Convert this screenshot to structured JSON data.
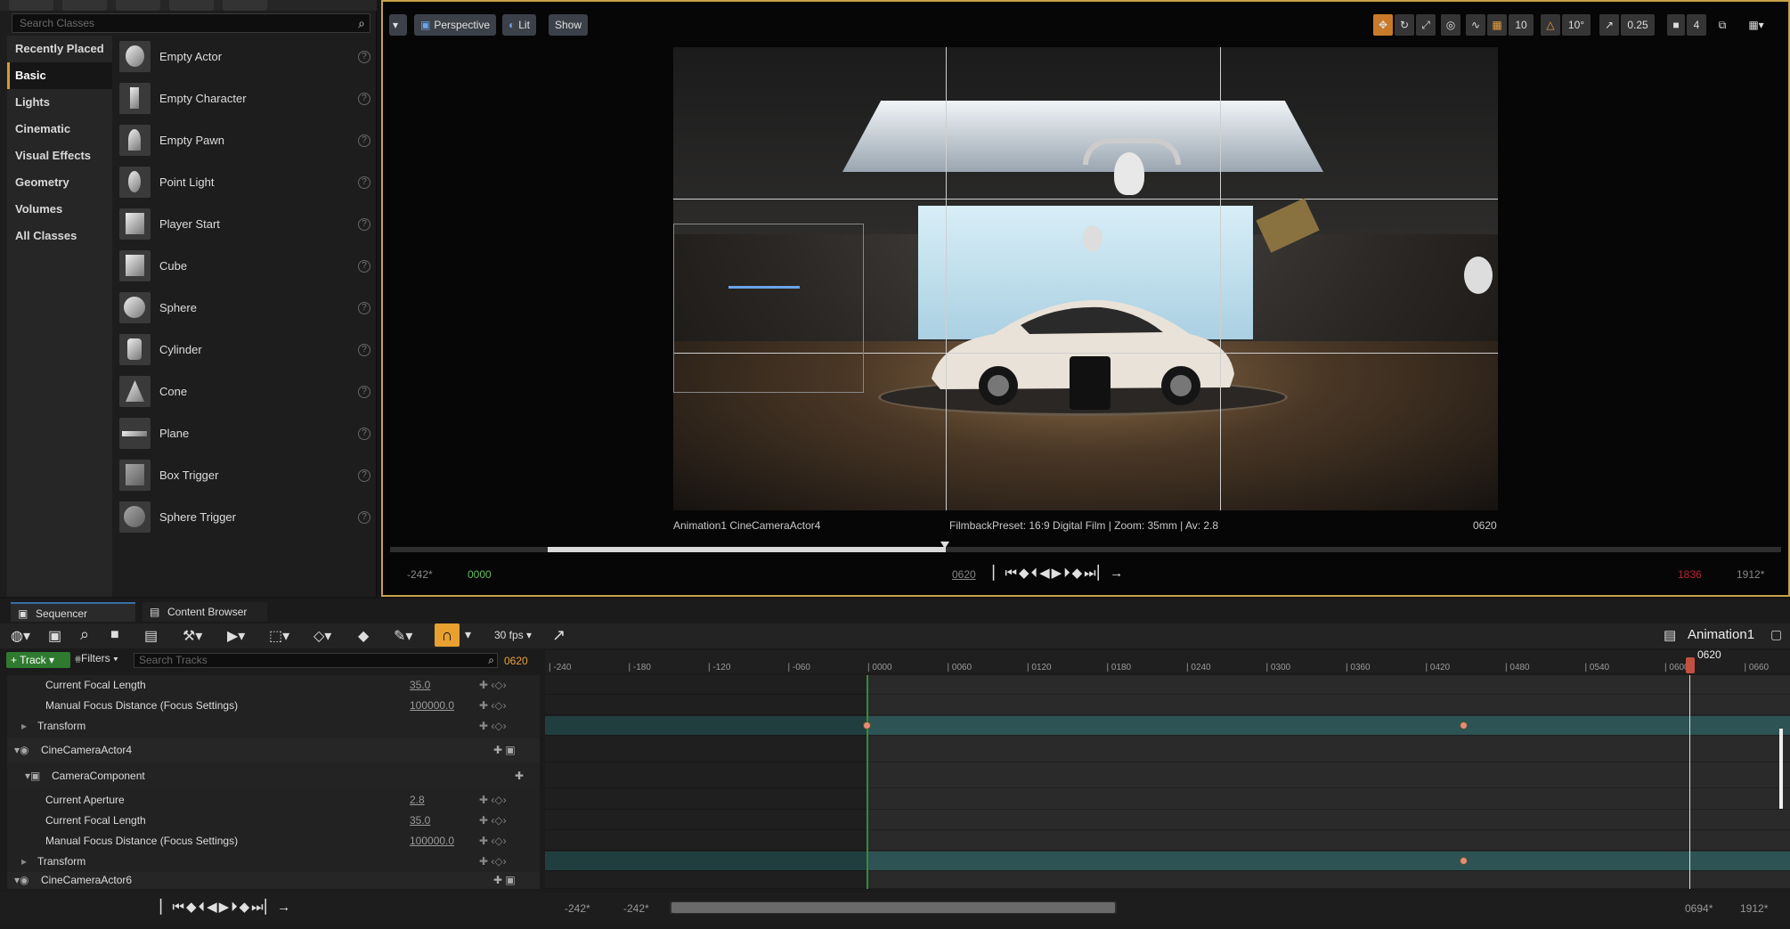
{
  "place_panel": {
    "search_placeholder": "Search Classes",
    "categories": [
      "Recently Placed",
      "Basic",
      "Lights",
      "Cinematic",
      "Visual Effects",
      "Geometry",
      "Volumes",
      "All Classes"
    ],
    "selected_category": "Basic",
    "items": [
      "Empty Actor",
      "Empty Character",
      "Empty Pawn",
      "Point Light",
      "Player Start",
      "Cube",
      "Sphere",
      "Cylinder",
      "Cone",
      "Plane",
      "Box Trigger",
      "Sphere Trigger"
    ]
  },
  "viewport": {
    "perspective_label": "Perspective",
    "lit_label": "Lit",
    "show_label": "Show",
    "grid_value": "10",
    "rotation_value": "10°",
    "scale_value": "0.25",
    "camera_speed": "4",
    "info_left": "Animation1  CineCameraActor4",
    "info_center": "FilmbackPreset: 16:9 Digital Film | Zoom: 35mm | Av: 2.8",
    "info_right": "0620",
    "start_time": "-242*",
    "in_time": "0000",
    "current_time": "0620",
    "out_time": "1836",
    "end_time": "1912*"
  },
  "sequencer": {
    "tab_sequencer": "Sequencer",
    "tab_content_browser": "Content Browser",
    "fps": "30 fps",
    "sequence_name": "Animation1",
    "track_label": "Track",
    "filters_label": "Filters",
    "search_placeholder": "Search Tracks",
    "current_frame": "0620",
    "playhead_label": "0620",
    "ruler_ticks": [
      "-240",
      "-180",
      "-120",
      "-060",
      "0000",
      "0060",
      "0120",
      "0180",
      "0240",
      "0300",
      "0360",
      "0420",
      "0480",
      "0540",
      "0600",
      "0660"
    ],
    "rows": [
      {
        "label": "Current Focal Length",
        "value": "35.0"
      },
      {
        "label": "Manual Focus Distance (Focus Settings)",
        "value": "100000.0"
      },
      {
        "label": "Transform",
        "value": ""
      },
      {
        "label": "CineCameraActor4",
        "value": ""
      },
      {
        "label": "CameraComponent",
        "value": ""
      },
      {
        "label": "Current Aperture",
        "value": "2.8"
      },
      {
        "label": "Current Focal Length",
        "value": "35.0"
      },
      {
        "label": "Manual Focus Distance (Focus Settings)",
        "value": "100000.0"
      },
      {
        "label": "Transform",
        "value": ""
      },
      {
        "label": "CineCameraActor6",
        "value": ""
      }
    ],
    "bottom_start": "-242*",
    "bottom_start2": "-242*",
    "bottom_end1": "0694*",
    "bottom_end2": "1912*"
  },
  "colors": {
    "accent": "#c8a04a",
    "teal_track": "#2d5354",
    "key": "#e88a7a",
    "track_button": "#2f7a2f"
  }
}
